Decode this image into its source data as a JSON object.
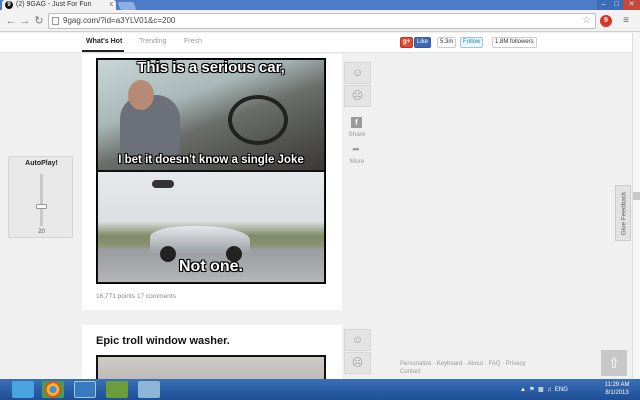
{
  "browser": {
    "tab_title": "(2) 9GAG - Just For Fun",
    "tab_close": "x",
    "url": "9gag.com/?id=a3YLV01&c=200",
    "back_icon": "arrow-left-icon",
    "forward_icon": "arrow-right-icon",
    "reload_icon": "reload-icon"
  },
  "site_nav": {
    "tabs": [
      {
        "label": "What's Hot",
        "active": true
      },
      {
        "label": "Trending",
        "active": false
      },
      {
        "label": "Fresh",
        "active": false
      }
    ]
  },
  "social": {
    "gplus": "g+",
    "fb_like": "Like",
    "fb_count": "5.3m",
    "twitter_follow": "Follow",
    "twitter_count": "1.8M followers"
  },
  "autoplay": {
    "title": "AutoPlay!",
    "value": "20",
    "level": 0.45
  },
  "post1": {
    "caption_top": "This is a serious car,",
    "caption_middle": "I bet it doesn't know a single Joke",
    "caption_bottom": "Not one.",
    "meta": "16,771 points 17 comments"
  },
  "actions": {
    "upvote_icon": "smile-icon",
    "downvote_icon": "frown-icon",
    "share_label": "Share",
    "more_label": "More"
  },
  "post2": {
    "title": "Epic troll window washer."
  },
  "footer": {
    "links": [
      "Personalize",
      "Keyboard",
      "About",
      "FAQ",
      "Privacy",
      "Contact"
    ]
  },
  "feedback_label": "Give Feedback",
  "taskbar": {
    "lang": "ENG",
    "time": "11:29 AM",
    "date": "8/1/2013"
  },
  "colors": {
    "tabstrip": "#4e7cc8",
    "taskbar": "#1f4f96",
    "accent_red": "#d8352a"
  }
}
